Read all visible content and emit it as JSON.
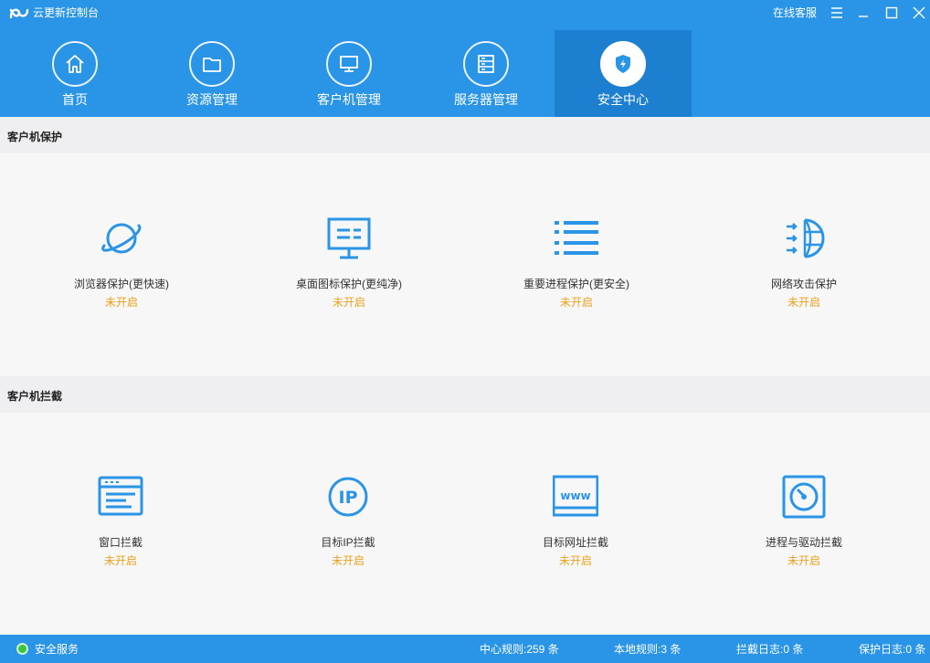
{
  "app": {
    "title": "云更新控制台",
    "support_label": "在线客服"
  },
  "nav": {
    "tabs": [
      {
        "label": "首页",
        "icon": "home-icon"
      },
      {
        "label": "资源管理",
        "icon": "folder-icon"
      },
      {
        "label": "客户机管理",
        "icon": "monitor-icon"
      },
      {
        "label": "服务器管理",
        "icon": "server-icon"
      },
      {
        "label": "安全中心",
        "icon": "shield-icon",
        "active": true
      }
    ]
  },
  "sections": {
    "protection": {
      "title": "客户机保护",
      "items": [
        {
          "label": "浏览器保护(更快速)",
          "status": "未开启",
          "icon": "browser-planet-icon"
        },
        {
          "label": "桌面图标保护(更纯净)",
          "status": "未开启",
          "icon": "desktop-monitor-icon"
        },
        {
          "label": "重要进程保护(更安全)",
          "status": "未开启",
          "icon": "process-list-icon"
        },
        {
          "label": "网络攻击保护",
          "status": "未开启",
          "icon": "network-firewall-icon"
        }
      ]
    },
    "interception": {
      "title": "客户机拦截",
      "items": [
        {
          "label": "窗口拦截",
          "status": "未开启",
          "icon": "window-icon"
        },
        {
          "label": "目标IP拦截",
          "status": "未开启",
          "icon": "ip-icon"
        },
        {
          "label": "目标网址拦截",
          "status": "未开启",
          "icon": "www-icon"
        },
        {
          "label": "进程与驱动拦截",
          "status": "未开启",
          "icon": "disk-drive-icon"
        }
      ]
    }
  },
  "statusbar": {
    "service": "安全服务",
    "center_rules": "中心规则:259 条",
    "local_rules": "本地规则:3 条",
    "intercept_log": "拦截日志:0 条",
    "protect_log": "保护日志:0 条"
  },
  "colors": {
    "brand": "#2a94e6",
    "active_tab": "#1d7fd0",
    "status_off": "#e8a21c",
    "icon_blue": "#2a94e6",
    "ok_green": "#3fc33f"
  }
}
